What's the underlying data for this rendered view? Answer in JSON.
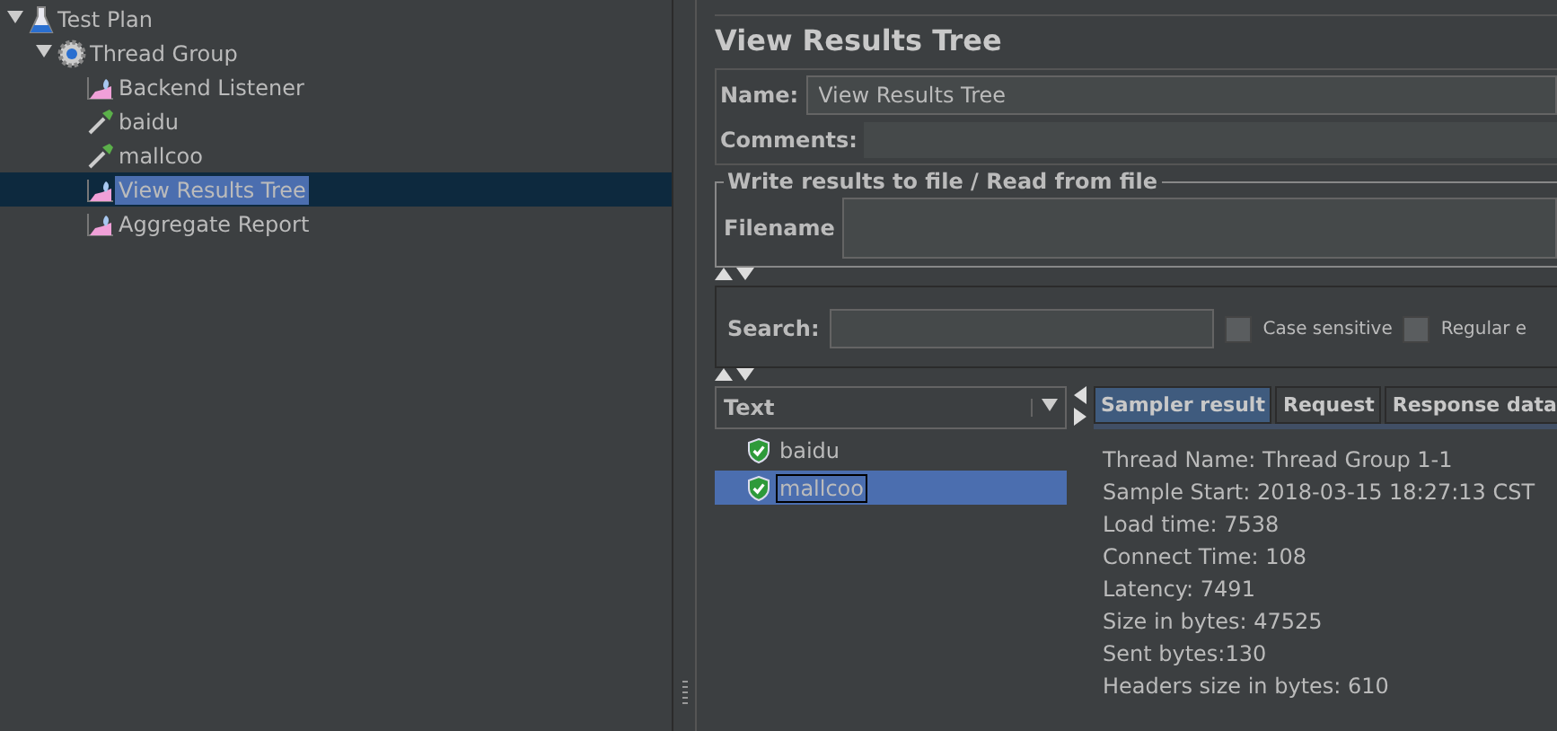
{
  "tree": [
    {
      "label": "Test Plan",
      "kind": "plan",
      "expanded": true,
      "selected": false,
      "children": [
        {
          "label": "Thread Group",
          "kind": "group",
          "expanded": true,
          "selected": false,
          "children": [
            {
              "label": "Backend Listener",
              "kind": "listener",
              "selected": false
            },
            {
              "label": "baidu",
              "kind": "sampler",
              "selected": false
            },
            {
              "label": "mallcoo",
              "kind": "sampler",
              "selected": false
            },
            {
              "label": "View Results Tree",
              "kind": "listener",
              "selected": true
            },
            {
              "label": "Aggregate Report",
              "kind": "listener",
              "selected": false
            }
          ]
        }
      ]
    }
  ],
  "panel": {
    "title": "View Results Tree",
    "name_label": "Name:",
    "name_value": "View Results Tree",
    "comments_label": "Comments:",
    "file_group": "Write results to file / Read from file",
    "filename_label": "Filename"
  },
  "search": {
    "label": "Search:",
    "options": [
      {
        "label": "Case sensitive",
        "checked": false
      },
      {
        "label": "Regular e",
        "checked": false
      }
    ]
  },
  "renderer": {
    "value": "Text"
  },
  "results": [
    {
      "label": "baidu",
      "selected": false
    },
    {
      "label": "mallcoo",
      "selected": true
    }
  ],
  "tabs": [
    {
      "label": "Sampler result",
      "selected": true
    },
    {
      "label": "Request",
      "selected": false
    },
    {
      "label": "Response data",
      "selected": false
    }
  ],
  "sampler_result": [
    "Thread Name: Thread Group 1-1",
    "Sample Start: 2018-03-15 18:27:13 CST",
    "Load time: 7538",
    "Connect Time: 108",
    "Latency: 7491",
    "Size in bytes: 47525",
    "Sent bytes:130",
    "Headers size in bytes: 610"
  ]
}
